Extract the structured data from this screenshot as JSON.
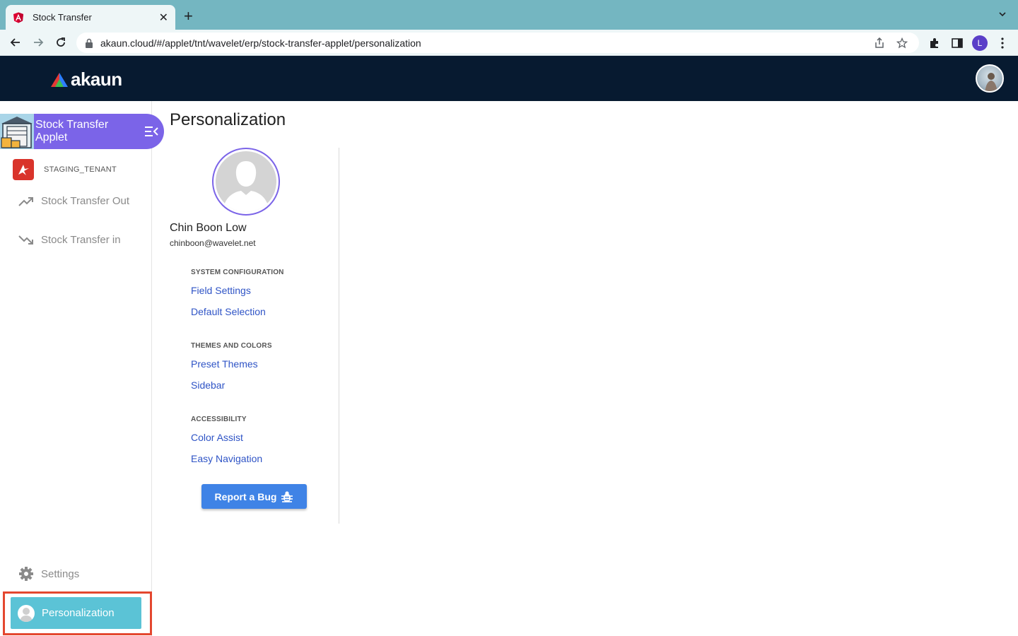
{
  "browser": {
    "tab_title": "Stock Transfer",
    "url": "akaun.cloud/#/applet/tnt/wavelet/erp/stock-transfer-applet/personalization",
    "profile_initial": "L"
  },
  "header": {
    "logo_text": "akaun"
  },
  "sidebar": {
    "applet_title": "Stock Transfer Applet",
    "tenant": "STAGING_TENANT",
    "items": [
      {
        "label": "Stock Transfer Out",
        "icon": "trending-up-icon"
      },
      {
        "label": "Stock Transfer in",
        "icon": "trending-down-icon"
      }
    ],
    "settings_label": "Settings",
    "personalization_label": "Personalization"
  },
  "main": {
    "title": "Personalization",
    "user": {
      "name": "Chin Boon Low",
      "email": "chinboon@wavelet.net"
    },
    "sections": [
      {
        "label": "SYSTEM CONFIGURATION",
        "links": [
          "Field Settings",
          "Default Selection"
        ]
      },
      {
        "label": "THEMES AND COLORS",
        "links": [
          "Preset Themes",
          "Sidebar"
        ]
      },
      {
        "label": "ACCESSIBILITY",
        "links": [
          "Color Assist",
          "Easy Navigation"
        ]
      }
    ],
    "report_bug_label": "Report a Bug"
  },
  "colors": {
    "header_bg": "#071a30",
    "applet_banner": "#7b64e8",
    "link": "#2f54c6",
    "active_item": "#5bc3d6",
    "bug_button": "#3f83e6",
    "highlight_outline": "#e4472f"
  }
}
